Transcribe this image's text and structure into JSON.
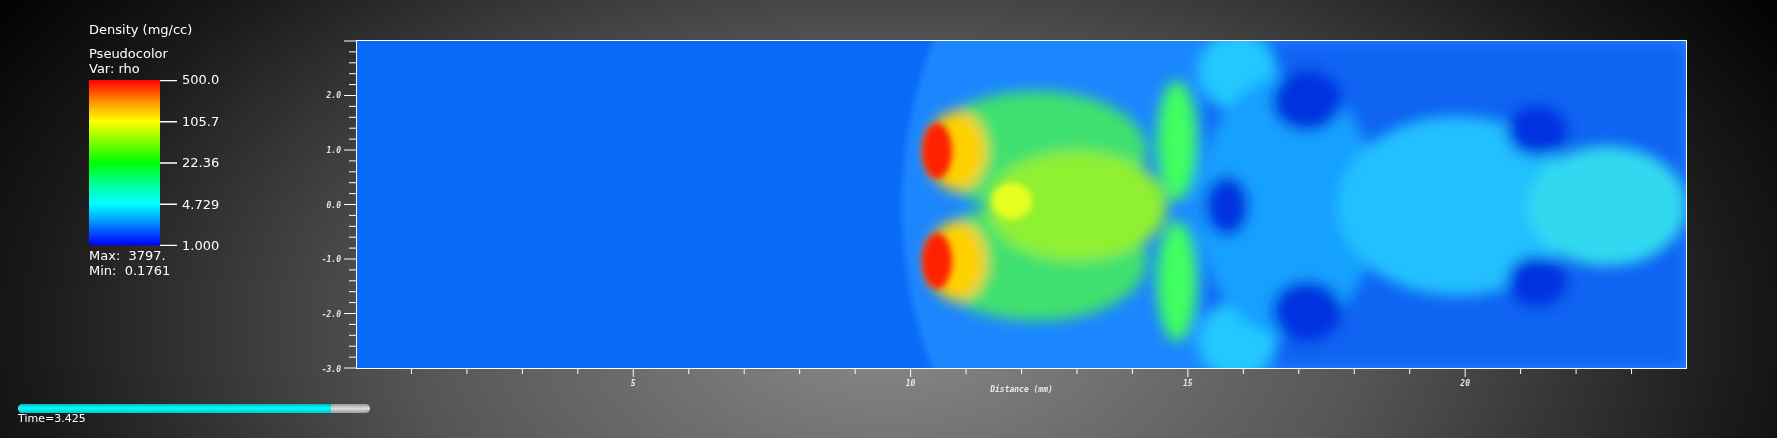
{
  "legend": {
    "title": "Density (mg/cc)",
    "plot_type": "Pseudocolor",
    "variable": "Var: rho",
    "labels": [
      "500.0",
      "105.7",
      "22.36",
      "4.729",
      "1.000"
    ],
    "max": "Max:  3797.",
    "min": "Min:  0.1761"
  },
  "plot": {
    "y_ticks": [
      "2.0",
      "1.0",
      "0.0",
      "-1.0",
      "-2.0",
      "-3.0"
    ],
    "x_ticks": [
      "5",
      "10",
      "15",
      "20"
    ],
    "x_title": "Distance (mm)"
  },
  "time_slider": {
    "label": "Time=3.425",
    "level": 0.89
  }
}
